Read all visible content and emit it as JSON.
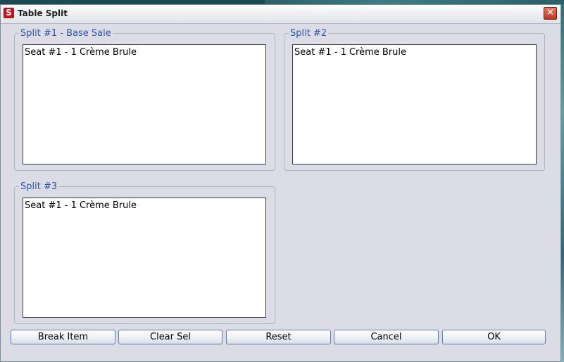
{
  "window": {
    "title": "Table Split",
    "app_icon_letter": "S",
    "close_label": "✕"
  },
  "splits": [
    {
      "legend": "Split #1 - Base Sale",
      "items": [
        "Seat #1 - 1 Crème Brule"
      ]
    },
    {
      "legend": "Split #2",
      "items": [
        "Seat #1 - 1 Crème Brule"
      ]
    },
    {
      "legend": "Split #3",
      "items": [
        "Seat #1 - 1 Crème Brule"
      ]
    }
  ],
  "buttons": {
    "break_item": "Break Item",
    "clear_sel": "Clear Sel",
    "reset": "Reset",
    "cancel": "Cancel",
    "ok": "OK"
  },
  "colors": {
    "legend_text": "#2857a8",
    "dialog_background": "#dcdce6",
    "close_button": "#c8321a"
  }
}
